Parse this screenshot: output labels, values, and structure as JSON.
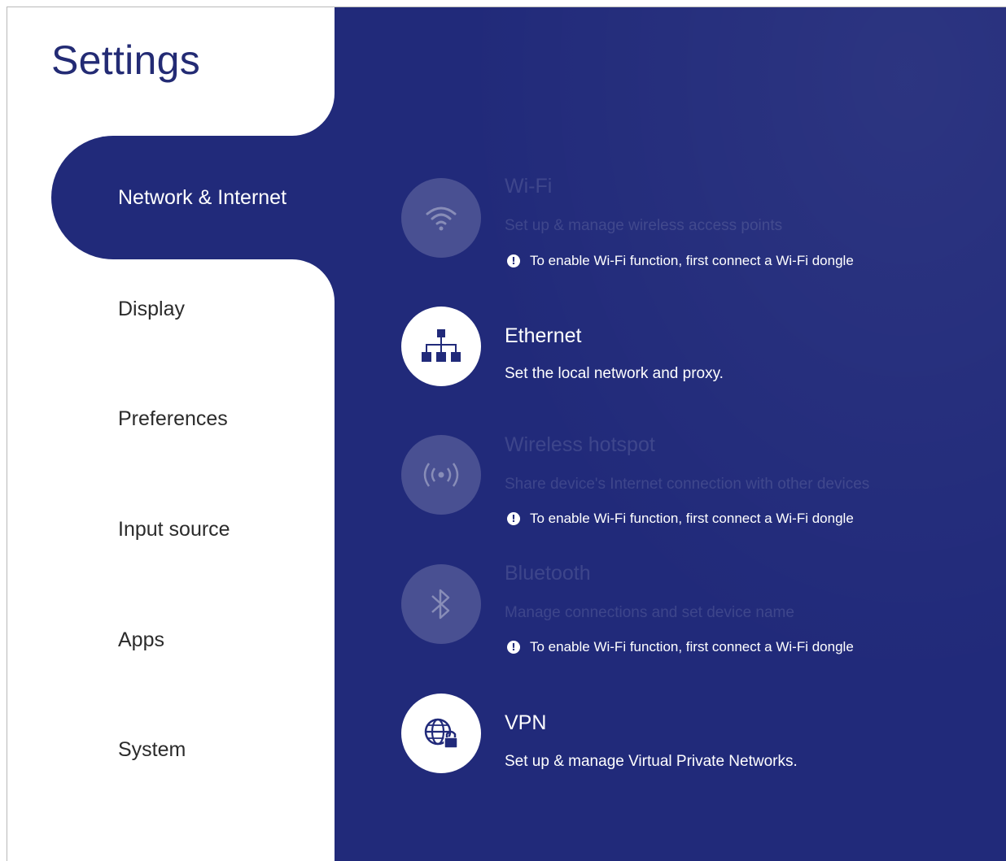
{
  "app": {
    "title": "Settings"
  },
  "sidebar": {
    "items": [
      {
        "label": "Network & Internet",
        "active": true
      },
      {
        "label": "Display",
        "active": false
      },
      {
        "label": "Preferences",
        "active": false
      },
      {
        "label": "Input source",
        "active": false
      },
      {
        "label": "Apps",
        "active": false
      },
      {
        "label": "System",
        "active": false
      }
    ]
  },
  "content": {
    "wifi": {
      "title": "Wi-Fi",
      "description": "Set up & manage wireless access points",
      "notice": "To enable Wi-Fi function, first connect a Wi-Fi dongle",
      "icon": "wifi-icon",
      "enabled": false
    },
    "ethernet": {
      "title": "Ethernet",
      "description": "Set the local network and proxy.",
      "icon": "network-icon",
      "enabled": true
    },
    "hotspot": {
      "title": "Wireless hotspot",
      "description": "Share device's Internet connection with other devices",
      "notice": "To enable Wi-Fi function, first connect a Wi-Fi dongle",
      "icon": "hotspot-icon",
      "enabled": false
    },
    "bluetooth": {
      "title": "Bluetooth",
      "description": "Manage connections and set device name",
      "notice": "To enable Wi-Fi function, first connect a Wi-Fi dongle",
      "icon": "bluetooth-icon",
      "enabled": false
    },
    "vpn": {
      "title": "VPN",
      "description": "Set up & manage Virtual Private Networks.",
      "icon": "vpn-globe-lock-icon",
      "enabled": true
    }
  },
  "colors": {
    "accent": "#212a7a",
    "title": "#232b74",
    "nav_text": "#2b2b2b",
    "background": "#ffffff"
  }
}
